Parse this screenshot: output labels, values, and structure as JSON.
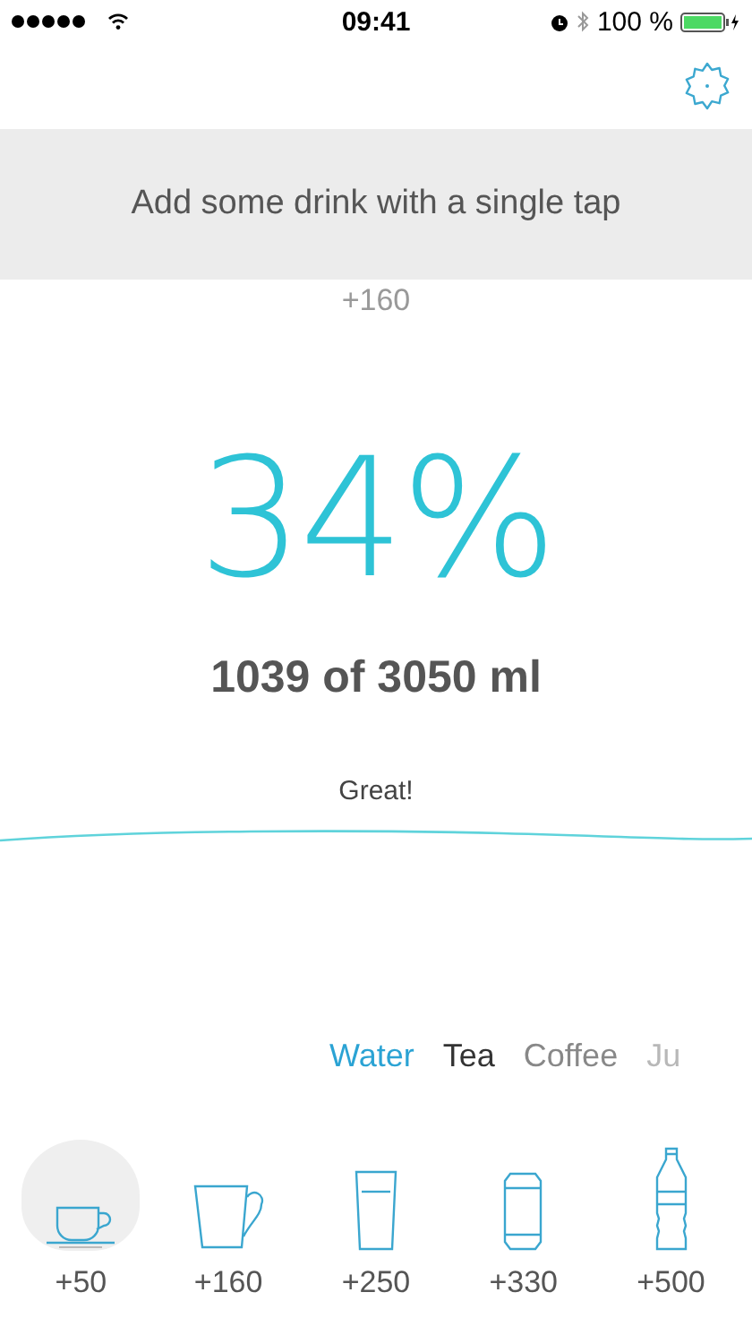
{
  "status_bar": {
    "time": "09:41",
    "battery": "100 %"
  },
  "banner": {
    "text": "Add some drink with a single tap"
  },
  "last_added": "+160",
  "percent": "34%",
  "amount": "1039 of 3050 ml",
  "message": "Great!",
  "drink_types": [
    {
      "label": "Water",
      "selected": true
    },
    {
      "label": "Tea",
      "selected": false
    },
    {
      "label": "Coffee",
      "selected": false
    },
    {
      "label": "Ju",
      "selected": false
    }
  ],
  "portions": [
    {
      "kind": "cup",
      "label": "+50",
      "selected": true
    },
    {
      "kind": "mug",
      "label": "+160",
      "selected": false
    },
    {
      "kind": "glass",
      "label": "+250",
      "selected": false
    },
    {
      "kind": "can",
      "label": "+330",
      "selected": false
    },
    {
      "kind": "bottle",
      "label": "+500",
      "selected": false
    }
  ]
}
